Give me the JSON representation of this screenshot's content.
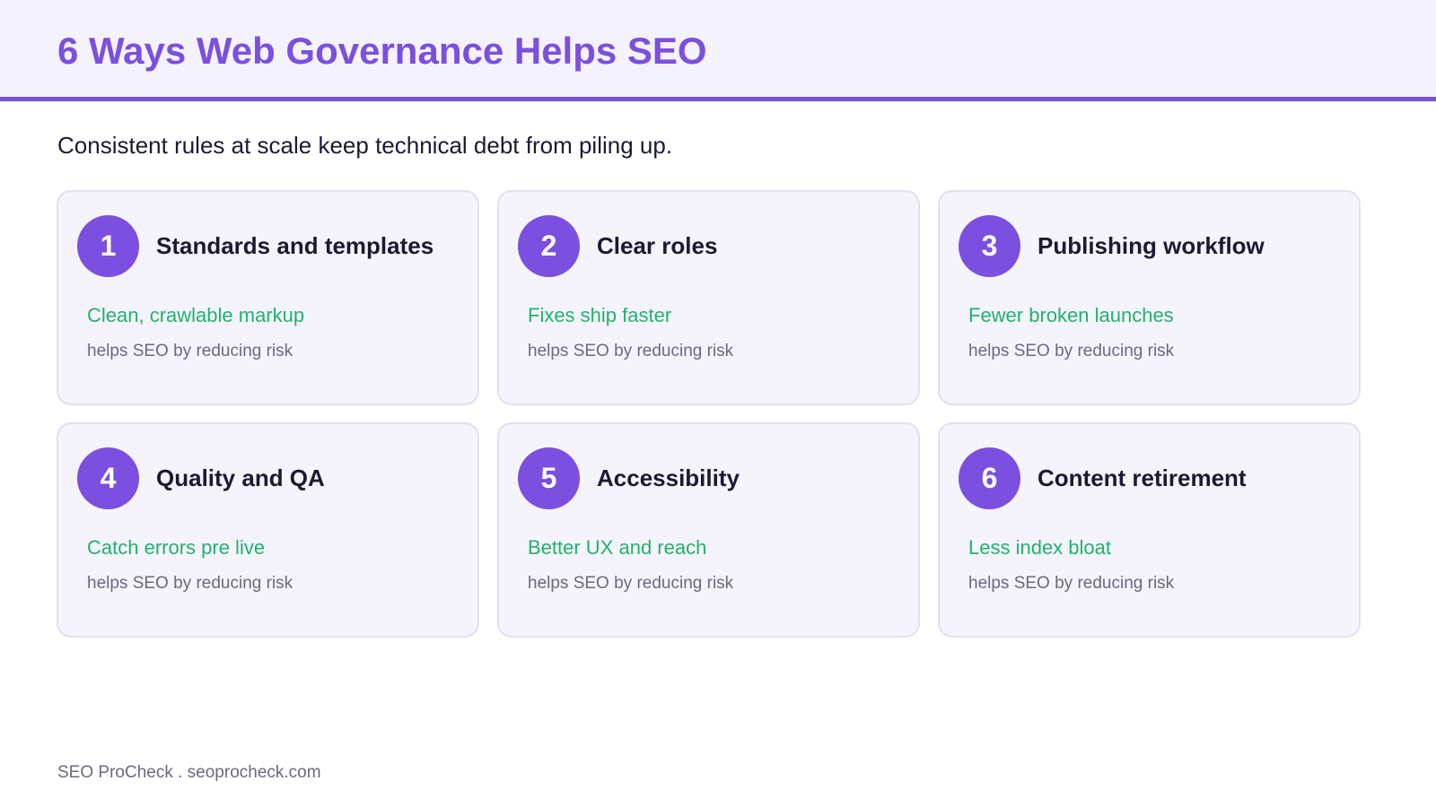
{
  "title": "6 Ways Web Governance Helps SEO",
  "subtitle": "Consistent rules at scale keep technical debt from piling up.",
  "cards": [
    {
      "number": "1",
      "title": "Standards and templates",
      "benefit": "Clean, crawlable markup",
      "note": "helps SEO by reducing risk"
    },
    {
      "number": "2",
      "title": "Clear roles",
      "benefit": "Fixes ship faster",
      "note": "helps SEO by reducing risk"
    },
    {
      "number": "3",
      "title": "Publishing workflow",
      "benefit": "Fewer broken launches",
      "note": "helps SEO by reducing risk"
    },
    {
      "number": "4",
      "title": "Quality and QA",
      "benefit": "Catch errors pre live",
      "note": "helps SEO by reducing risk"
    },
    {
      "number": "5",
      "title": "Accessibility",
      "benefit": "Better UX and reach",
      "note": "helps SEO by reducing risk"
    },
    {
      "number": "6",
      "title": "Content retirement",
      "benefit": "Less index bloat",
      "note": "helps SEO by reducing risk"
    }
  ],
  "footer": "SEO ProCheck . seoprocheck.com",
  "colors": {
    "accent": "#7b4fe0",
    "benefit": "#1fb36c",
    "header_bg": "#f4f2fc",
    "card_bg": "#f5f4fc",
    "card_border": "#e3e0f1",
    "text": "#1c1a33",
    "muted": "#6b6880"
  }
}
